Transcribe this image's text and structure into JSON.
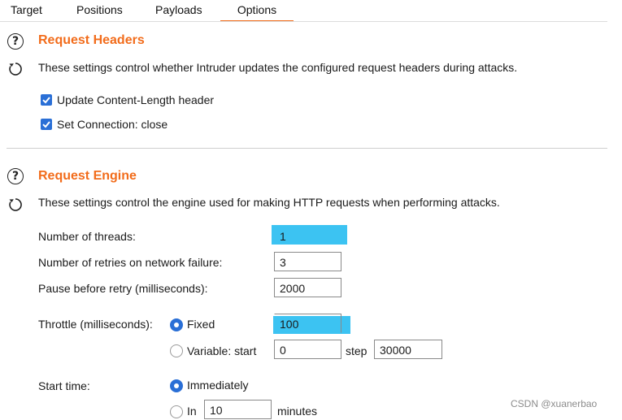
{
  "tabs": [
    {
      "label": "Target"
    },
    {
      "label": "Positions"
    },
    {
      "label": "Payloads"
    },
    {
      "label": "Options",
      "active": true
    }
  ],
  "request_headers": {
    "title": "Request Headers",
    "description": "These settings control whether Intruder updates the configured request headers during attacks.",
    "checkboxes": [
      {
        "label": "Update Content-Length header",
        "checked": true
      },
      {
        "label": "Set Connection: close",
        "checked": true
      }
    ]
  },
  "request_engine": {
    "title": "Request Engine",
    "description": "These settings control the engine used for making HTTP requests when performing attacks.",
    "threads_label": "Number of threads:",
    "threads_value": "1",
    "retries_label": "Number of retries on network failure:",
    "retries_value": "3",
    "pause_label": "Pause before retry (milliseconds):",
    "pause_value": "2000",
    "throttle_label": "Throttle (milliseconds):",
    "throttle_fixed_label": "Fixed",
    "throttle_fixed_value": "100",
    "throttle_variable_label": "Variable:  start",
    "throttle_variable_start": "0",
    "throttle_step_label": "step",
    "throttle_step_value": "30000",
    "start_time_label": "Start time:",
    "start_immediately_label": "Immediately",
    "start_in_label": "In",
    "start_in_value": "10",
    "start_in_unit": "minutes"
  },
  "watermark": "CSDN @xuanerbao",
  "colors": {
    "accent": "#f26c1b",
    "checkbox": "#2a6fd6",
    "highlight": "#3cc3f2"
  },
  "icons": [
    "help-icon",
    "refresh-icon",
    "checkmark-icon"
  ]
}
